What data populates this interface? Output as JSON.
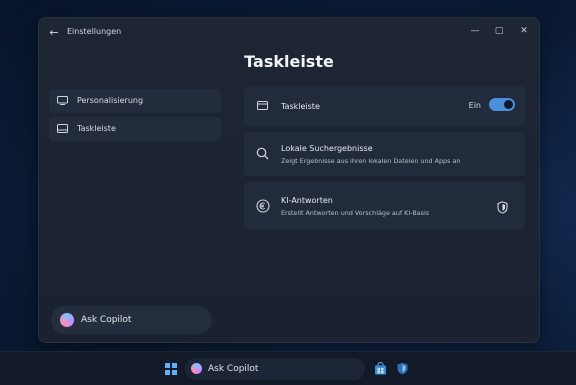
{
  "window": {
    "title": "Einstellungen",
    "back_icon": "back-arrow-icon",
    "controls": [
      "minimize-icon",
      "maximize-icon",
      "close-icon"
    ]
  },
  "page": {
    "heading": "Taskleiste"
  },
  "sidebar": {
    "items": [
      {
        "label": "Personalisierung",
        "icon": "monitor-icon"
      },
      {
        "label": "Taskleiste",
        "icon": "taskbar-icon"
      }
    ],
    "copilot_label": "Ask Copilot"
  },
  "settings": [
    {
      "title": "Taskleiste",
      "icon": "taskbar-icon",
      "toggle_label": "Ein",
      "toggle_on": true
    },
    {
      "title": "Lokale Suchergebnisse",
      "description": "Zeigt Ergebnisse aus ihren lokalen Dateien und Apps an",
      "icon": "search-icon"
    },
    {
      "title": "KI-Antworten",
      "description": "Erstellt Antworten und Vorschläge auf KI-Basis",
      "icon": "ai-coin-icon",
      "trailing_icon": "shield-icon"
    }
  ],
  "taskbar": {
    "search_label": "Ask Copilot",
    "apps": [
      "store-icon",
      "security-shield-icon"
    ]
  },
  "colors": {
    "accent": "#4a8fd9",
    "window_bg": "#1e2635",
    "card_bg": "#222b3b"
  }
}
